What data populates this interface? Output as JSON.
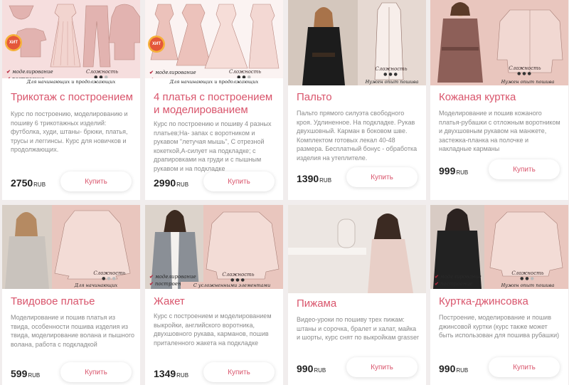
{
  "currency": "RUB",
  "buy_label": "Купить",
  "image_text": {
    "complexity": "Сложность",
    "modeling": "моделирование",
    "construction": "построение",
    "beginners": "Для начинающих и продолжающих",
    "beginners_short": "Для начинающих",
    "experience": "Нужен опыт пошива",
    "complicated": "С усложненными элементами",
    "hit": "ХИТ"
  },
  "products": [
    {
      "title": "Трикотаж с построением",
      "description": "Курс по построению, моделированию и пошиву 6 трикотажных изделий: футболка, худи, штаны- брюки, платья, трусы и леггинсы. Курс для новичков и продолжающих.",
      "price": "2750",
      "complexity_level": 2
    },
    {
      "title": "4 платья с построением и моделированием",
      "description": "Курс по построению и пошиву 4 разных платьев;На- запах с воротником и рукавом \"летучая мышь\", С отрезной кокеткой,А-силует на подкладке; с драпировками на груди и с пышным рукавом и на подкладке",
      "price": "2990",
      "complexity_level": 2
    },
    {
      "title": "Пальто",
      "description": "Пальто прямого силуэта свободного кроя. Удлиненное. На подкладке. Рукав двухшовный. Карман в боковом шве. Комплектом готовых лекал 40-48 размера. Бесплатный бонус - обработка изделия на утеплителе.",
      "price": "1390",
      "complexity_level": 3
    },
    {
      "title": "Кожаная куртка",
      "description": "Моделирование и пошив кожаного платья-рубашки с отложным воротником и двухшовным рукавом на манжете, застежка-планка на полочке и накладные карманы",
      "price": "999",
      "complexity_level": 3
    },
    {
      "title": "Твидовое платье",
      "description": "Моделирование и пошив платья из твида, особенности пошива изделия из твида, моделирование волана и пышного волана, работа с подкладкой",
      "price": "599",
      "complexity_level": 1
    },
    {
      "title": "Жакет",
      "description": "Курс с построением и моделированием выкройки, английского воротника, двухшовного рукава, карманов, пошив приталенного жакета на подкладке",
      "price": "1349",
      "complexity_level": 3
    },
    {
      "title": "Пижама",
      "description": "Видео-уроки по пошиву трех пижам: штаны и сорочка, бралет и халат, майка и шорты, курс снят по выкройкам grasser",
      "price": "990",
      "complexity_level": 1
    },
    {
      "title": "Куртка-джинсовка",
      "description": "Построение, моделирование и пошив джинсовой куртки (курс также может быть использован для пошива рубашки)",
      "price": "990",
      "complexity_level": 2
    }
  ],
  "colors": {
    "accent": "#d9556c",
    "image_bg": "#e9c6be",
    "page_bg": "#f1eded"
  }
}
